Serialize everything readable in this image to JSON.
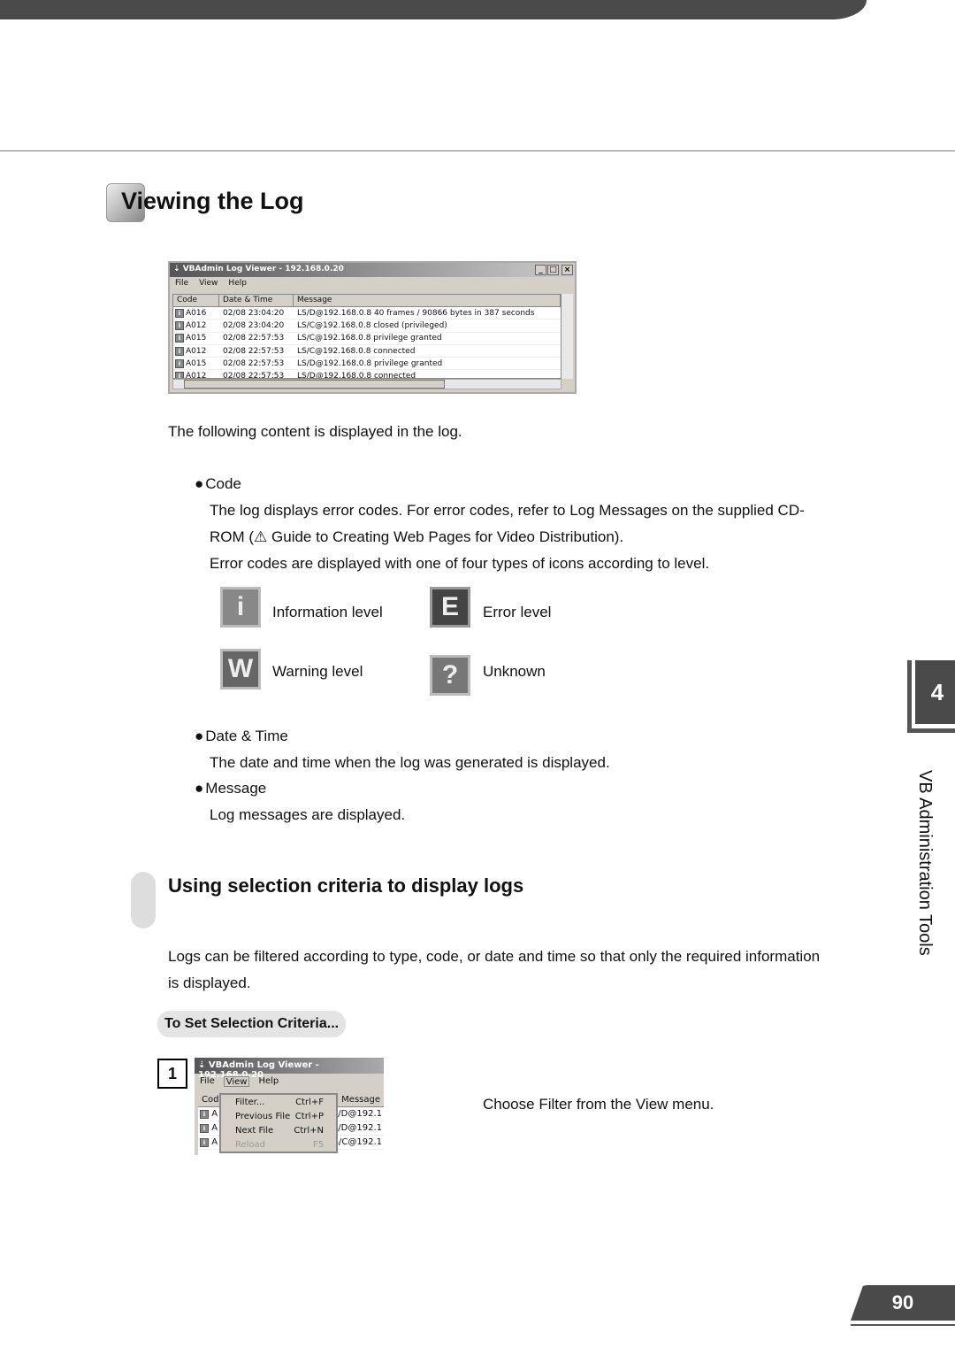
{
  "section": {
    "title": "Viewing the Log",
    "chapter_number": "4",
    "chapter_name": "VB Administration Tools",
    "page_number": "90"
  },
  "log_viewer": {
    "title": "VBAdmin Log Viewer - 192.168.0.20",
    "menu": [
      "File",
      "View",
      "Help"
    ],
    "columns": [
      "Code",
      "Date & Time",
      "Message"
    ],
    "rows": [
      {
        "code": "A016",
        "datetime": "02/08 23:04:20",
        "message": "LS/D@192.168.0.8 40 frames / 90866 bytes in 387 seconds"
      },
      {
        "code": "A012",
        "datetime": "02/08 23:04:20",
        "message": "LS/C@192.168.0.8 closed (privileged)"
      },
      {
        "code": "A015",
        "datetime": "02/08 22:57:53",
        "message": "LS/C@192.168.0.8 privilege granted"
      },
      {
        "code": "A012",
        "datetime": "02/08 22:57:53",
        "message": "LS/C@192.168.0.8 connected"
      },
      {
        "code": "A015",
        "datetime": "02/08 22:57:53",
        "message": "LS/D@192.168.0.8 privilege granted"
      },
      {
        "code": "A012",
        "datetime": "02/08 22:57:53",
        "message": "LS/D@192.168.0.8 connected"
      }
    ]
  },
  "intro": "The following content is displayed in the log.",
  "code": {
    "heading": "Code",
    "text1": "The log displays error codes. For error codes, refer to Log Messages on the supplied CD-",
    "text2a": "ROM (",
    "text2b": "Guide to Creating Web Pages for Video Distribution).",
    "text3": "Error codes are displayed with one of four types of icons according to level.",
    "levels": [
      {
        "glyph": "i",
        "label": "Information level"
      },
      {
        "glyph": "E",
        "label": "Error level"
      },
      {
        "glyph": "W",
        "label": "Warning level"
      },
      {
        "glyph": "?",
        "label": "Unknown"
      }
    ]
  },
  "datetime": {
    "heading": "Date & Time",
    "text": "The date and time when the log was generated is displayed."
  },
  "message": {
    "heading": "Message",
    "text": "Log messages are displayed."
  },
  "selection": {
    "heading": "Using selection criteria to display logs",
    "text1": "Logs can be filtered according to type, code, or date and time so that only the required information",
    "text2": "is displayed.",
    "procedure": "To Set Selection Criteria...",
    "step_number": "1",
    "step_text": "Choose Filter from the View menu.",
    "shot": {
      "title": "VBAdmin Log Viewer - 192.168.0.20",
      "menu": [
        "File",
        "View",
        "Help"
      ],
      "col_code": "Code",
      "col_message": "Message",
      "items": [
        {
          "label": "Filter...",
          "shortcut": "Ctrl+F"
        },
        {
          "label": "Previous File",
          "shortcut": "Ctrl+P"
        },
        {
          "label": "Next File",
          "shortcut": "Ctrl+N"
        },
        {
          "label": "Reload",
          "shortcut": "F5"
        }
      ],
      "rows": [
        "LS/D@192.1",
        "LS/D@192.1",
        "LS/C@192.1"
      ],
      "row_code": "A"
    }
  }
}
